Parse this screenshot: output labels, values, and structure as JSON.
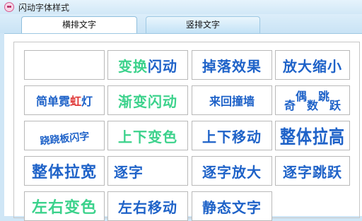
{
  "window": {
    "title": "闪动字体样式"
  },
  "tabs": [
    {
      "label": "横排文字",
      "active": true
    },
    {
      "label": "竖排文字",
      "active": false
    }
  ],
  "styles": {
    "blank": "",
    "flash_change": {
      "part1": "变换",
      "part2": "闪动"
    },
    "fall": "掉落效果",
    "zoom": "放大缩小",
    "neon": {
      "part1": "简单霓",
      "part2": "虹",
      "part3": "灯"
    },
    "gradient_flash": "渐变闪动",
    "back_forth": "来回撞墙",
    "odd_even": {
      "c1": "奇",
      "c2": "偶",
      "c3": "数",
      "c4": "跳",
      "c5": "跃"
    },
    "seesaw": "跷跷板闪字",
    "updown_color": "上下变色",
    "updown_move": "上下移动",
    "whole_raise": "整体拉高",
    "whole_widen": "整体拉宽",
    "char_by_char": "逐字",
    "char_zoom": "逐字放大",
    "char_jump": "逐字跳跃",
    "lr_color": "左右变色",
    "lr_move": "左右移动",
    "static": "静态文字"
  },
  "colors": {
    "blue": "#1e62c8",
    "green": "#3cd28c",
    "accent_pink": "#d55b8f"
  }
}
